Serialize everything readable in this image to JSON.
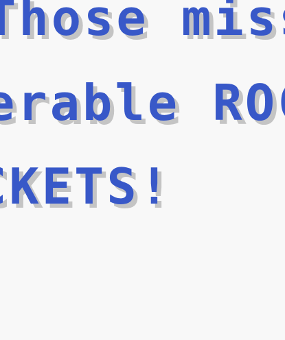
{
  "dialogue": {
    "lines": [
      "Those missi",
      "erable ROC",
      "CKETS!"
    ]
  },
  "colors": {
    "background": "#f8f8f8",
    "text": "#3858c8",
    "text_shadow": "#c4c4c4"
  }
}
